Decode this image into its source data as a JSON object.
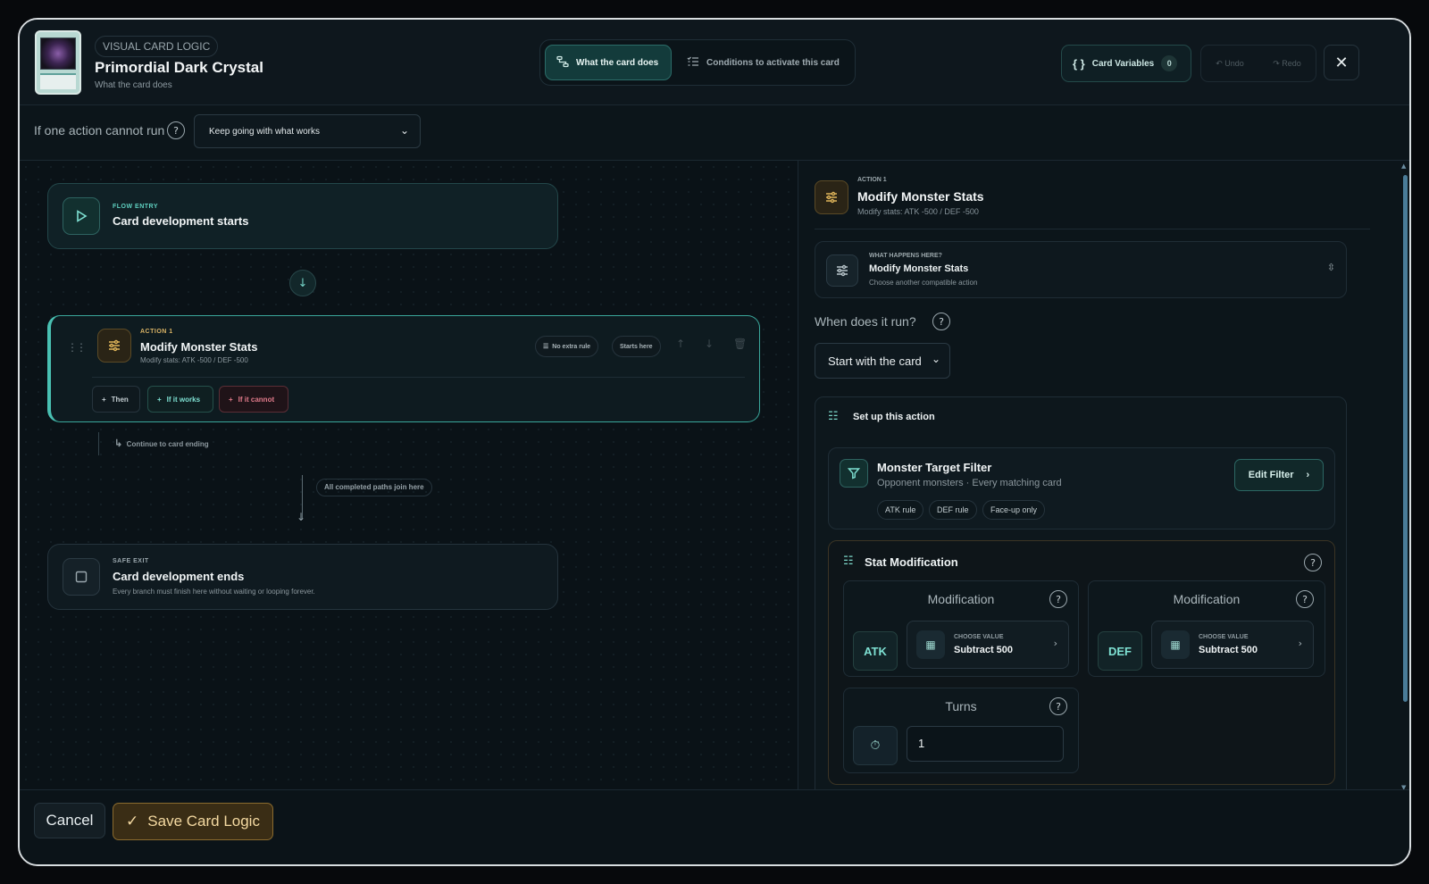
{
  "header": {
    "badge": "VISUAL CARD LOGIC",
    "title": "Primordial Dark Crystal",
    "subtitle": "What the card does",
    "tabs": [
      {
        "label": "What the card does",
        "icon": "flow-icon",
        "active": true
      },
      {
        "label": "Conditions to activate this card",
        "icon": "checklist-icon",
        "active": false
      }
    ],
    "card_variables_label": "Card Variables",
    "card_variables_count": "0",
    "undo_label": "Undo",
    "redo_label": "Redo"
  },
  "policy": {
    "label": "If one action cannot run",
    "selected": "Keep going with what works"
  },
  "flow": {
    "entry": {
      "eyebrow": "FLOW ENTRY",
      "title": "Card development starts"
    },
    "action": {
      "eyebrow": "ACTION 1",
      "title": "Modify Monster Stats",
      "subtitle": "Modify stats: ATK -500 / DEF -500",
      "rule_chip": "No extra rule",
      "start_chip": "Starts here",
      "branches": {
        "then": "Then",
        "if_works": "If it works",
        "if_cannot": "If it cannot"
      }
    },
    "continue_text": "Continue to card ending",
    "join_text": "All completed paths join here",
    "exit": {
      "eyebrow": "SAFE EXIT",
      "title": "Card development ends",
      "subtitle": "Every branch must finish here without waiting or looping forever."
    }
  },
  "panel": {
    "eyebrow": "ACTION 1",
    "title": "Modify Monster Stats",
    "subtitle": "Modify stats: ATK -500 / DEF -500",
    "what": {
      "eyebrow": "WHAT HAPPENS HERE?",
      "title": "Modify Monster Stats",
      "subtitle": "Choose another compatible action"
    },
    "when_label": "When does it run?",
    "when_selected": "Start with the card",
    "setup_title": "Set up this action",
    "filter": {
      "title": "Monster Target Filter",
      "subtitle": "Opponent monsters · Every matching card",
      "tags": [
        "ATK rule",
        "DEF rule",
        "Face-up only"
      ],
      "edit_label": "Edit Filter"
    },
    "stat_mod": {
      "title": "Stat Modification",
      "atk": {
        "label": "Modification",
        "stat": "ATK",
        "eyebrow": "CHOOSE VALUE",
        "value": "Subtract 500"
      },
      "def": {
        "label": "Modification",
        "stat": "DEF",
        "eyebrow": "CHOOSE VALUE",
        "value": "Subtract 500"
      },
      "turns": {
        "label": "Turns",
        "value": "1"
      }
    }
  },
  "footer": {
    "cancel_label": "Cancel",
    "save_label": "Save Card Logic"
  },
  "colors": {
    "accent": "#49c0b2",
    "warn": "#e0b55a",
    "danger": "#e07a8a"
  }
}
